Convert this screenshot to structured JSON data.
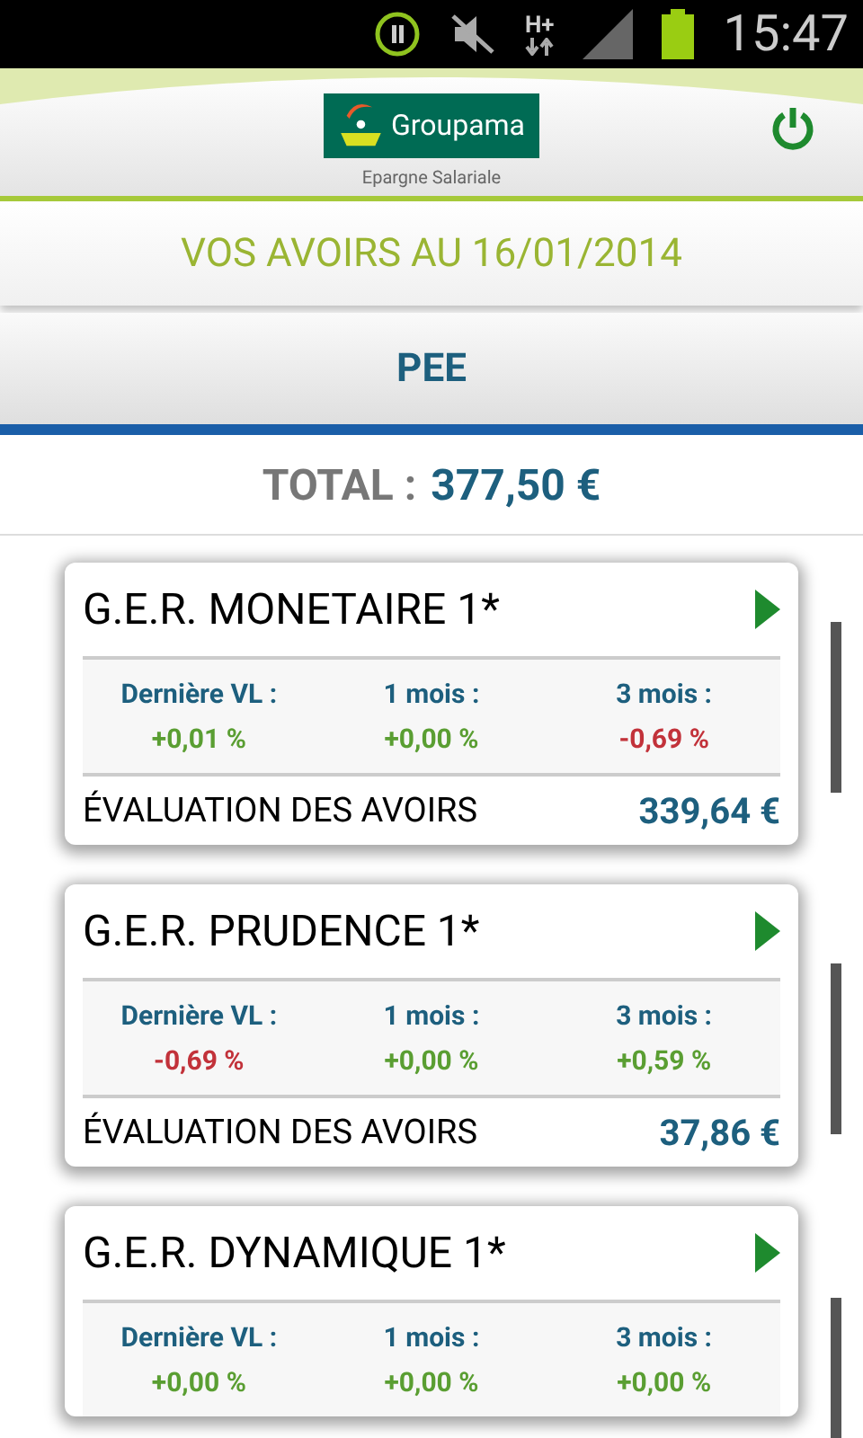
{
  "status_bar": {
    "network": "H+",
    "time": "15:47"
  },
  "header": {
    "logo_text": "Groupama",
    "logo_subtitle": "Epargne Salariale"
  },
  "title": "VOS AVOIRS AU 16/01/2014",
  "tabs": [
    {
      "label": "PEE",
      "selected": true
    }
  ],
  "total": {
    "label": "TOTAL :",
    "value": "377,50 €"
  },
  "funds": [
    {
      "name": "G.E.R. MONETAIRE 1*",
      "stats": [
        {
          "label": "Dernière VL :",
          "value": "+0,01 %",
          "color": "#5a9e32"
        },
        {
          "label": "1 mois :",
          "value": "+0,00 %",
          "color": "#5a9e32"
        },
        {
          "label": "3 mois :",
          "value": "-0,69 %",
          "color": "#c2323a"
        }
      ],
      "evaluation_label": "ÉVALUATION DES AVOIRS",
      "evaluation": "339,64 €"
    },
    {
      "name": "G.E.R. PRUDENCE 1*",
      "stats": [
        {
          "label": "Dernière VL :",
          "value": "-0,69 %",
          "color": "#c2323a"
        },
        {
          "label": "1 mois :",
          "value": "+0,00 %",
          "color": "#5a9e32"
        },
        {
          "label": "3 mois :",
          "value": "+0,59 %",
          "color": "#5a9e32"
        }
      ],
      "evaluation_label": "ÉVALUATION DES AVOIRS",
      "evaluation": "37,86 €"
    },
    {
      "name": "G.E.R. DYNAMIQUE 1*",
      "stats": [
        {
          "label": "Dernière VL :",
          "value": "+0,00 %",
          "color": "#5a9e32"
        },
        {
          "label": "1 mois :",
          "value": "+0,00 %",
          "color": "#5a9e32"
        },
        {
          "label": "3 mois :",
          "value": "+0,00 %",
          "color": "#5a9e32"
        }
      ]
    }
  ]
}
